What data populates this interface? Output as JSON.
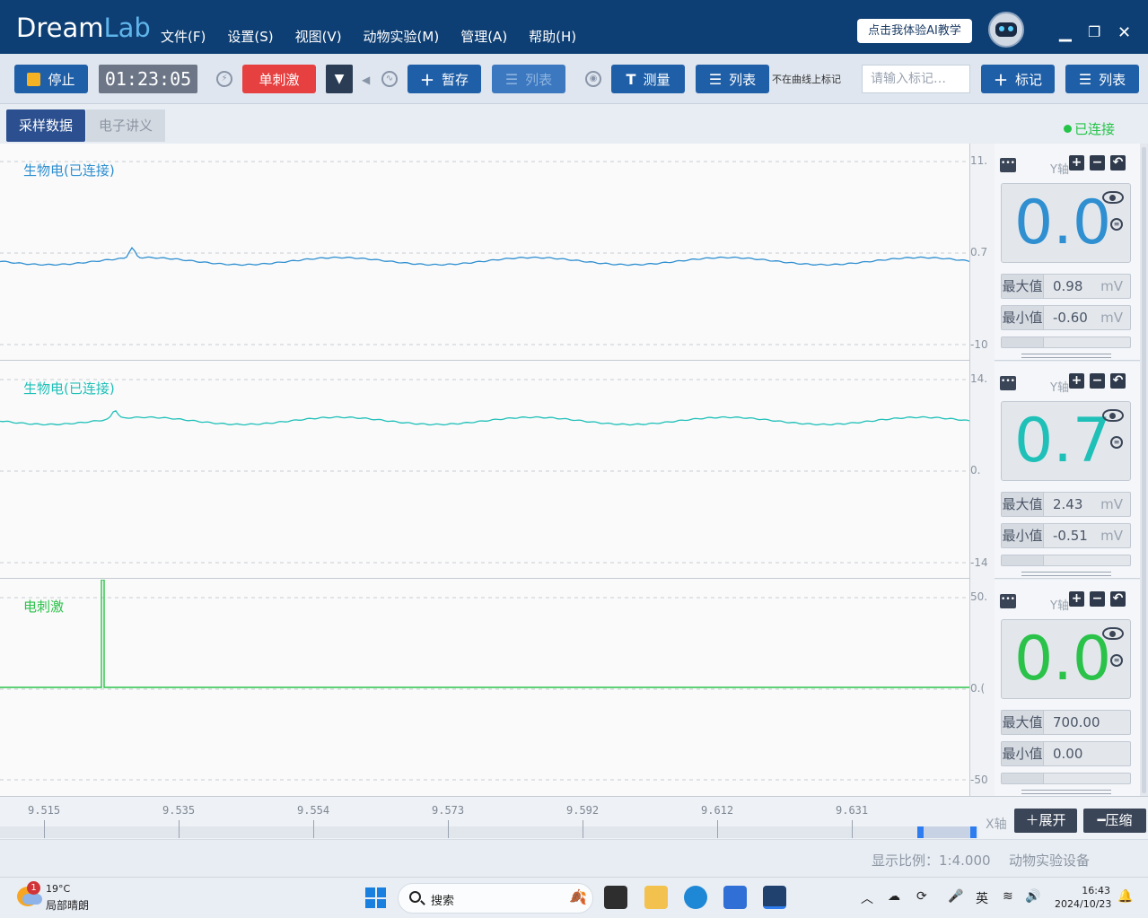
{
  "app": {
    "logo_part1": "Dream",
    "logo_part2": "Lab",
    "menu": [
      "文件(F)",
      "设置(S)",
      "视图(V)",
      "动物实验(M)",
      "管理(A)",
      "帮助(H)"
    ],
    "ai_button": "点击我体验AI教学",
    "window_controls": [
      "minimize-icon",
      "restore-icon",
      "close-icon"
    ]
  },
  "toolbar": {
    "stop_label": "停止",
    "timer": "01:23:05",
    "single_stim_label": "单刺激",
    "save_temp_label": "暂存",
    "list1_label": "列表",
    "measure_label": "测量",
    "list2_label": "列表",
    "not_on_curve_label": "不在曲线上标记",
    "mark_input_placeholder": "请输入标记…",
    "mark_label": "标记",
    "list3_label": "列表"
  },
  "tabs": {
    "active": "采样数据",
    "inactive": "电子讲义"
  },
  "connection_status": "已连接",
  "channels": [
    {
      "label": "生物电(已连接)",
      "color": "#2f8fd0",
      "y_top": "11.",
      "y_mid": "0.7",
      "y_bottom": "-10",
      "y_axis_label": "Y轴",
      "value": "0.0",
      "max_label": "最大值",
      "max": "0.98",
      "max_unit": "mV",
      "min_label": "最小值",
      "min": "-0.60",
      "min_unit": "mV"
    },
    {
      "label": "生物电(已连接)",
      "color": "#1fc0b8",
      "y_top": "14.",
      "y_mid": "0.",
      "y_bottom": "-14",
      "y_axis_label": "Y轴",
      "value": "0.7",
      "max_label": "最大值",
      "max": "2.43",
      "max_unit": "mV",
      "min_label": "最小值",
      "min": "-0.51",
      "min_unit": "mV"
    },
    {
      "label": "电刺激",
      "color": "#2bc24a",
      "y_top": "50.",
      "y_mid": "0.(",
      "y_bottom": "-50",
      "y_axis_label": "Y轴",
      "value": "0.0",
      "max_label": "最大值",
      "max": "700.00",
      "max_unit": "",
      "min_label": "最小值",
      "min": "0.00",
      "min_unit": ""
    }
  ],
  "x_axis": {
    "ticks": [
      "9.515",
      "9.535",
      "9.554",
      "9.573",
      "9.592",
      "9.612",
      "9.631"
    ],
    "label": "X轴",
    "expand_label": "展开",
    "compress_label": "压缩"
  },
  "status_bar": {
    "scale": "显示比例：1:4.000",
    "device": "动物实验设备"
  },
  "taskbar": {
    "weather_badge": "1",
    "temperature": "19°C",
    "weather": "局部晴朗",
    "search_label": "搜索",
    "ime": "英",
    "time": "16:43",
    "date": "2024/10/23"
  }
}
